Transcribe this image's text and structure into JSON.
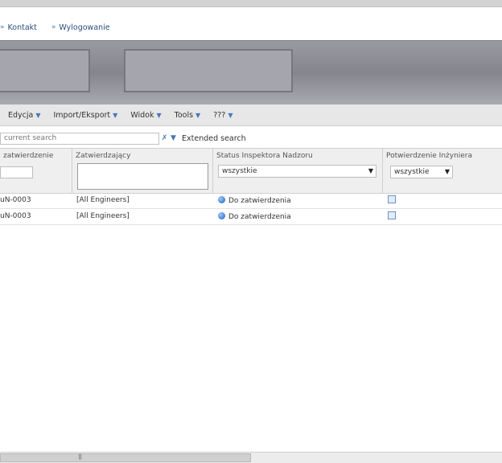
{
  "top_links": [
    {
      "label": "Kontakt",
      "icon": "double-arrow-icon"
    },
    {
      "label": "Wylogowanie",
      "icon": "double-arrow-icon"
    }
  ],
  "menu": [
    {
      "label": "Edycja"
    },
    {
      "label": "Import/Eksport"
    },
    {
      "label": "Widok"
    },
    {
      "label": "Tools"
    },
    {
      "label": "???"
    }
  ],
  "search": {
    "placeholder": "current search",
    "extended_label": "Extended search"
  },
  "grid": {
    "columns": [
      {
        "title": "zatwierdzenie"
      },
      {
        "title": "Zatwierdzający"
      },
      {
        "title": "Status Inspektora Nadzoru",
        "filter_value": "wszystkie"
      },
      {
        "title": "Potwierdzenie Inżyniera",
        "filter_value": "wszystkie"
      }
    ],
    "rows": [
      {
        "id": "uN-0003",
        "approver": "[All Engineers]",
        "status": "Do zatwierdzenia"
      },
      {
        "id": "uN-0003",
        "approver": "[All Engineers]",
        "status": "Do zatwierdzenia"
      }
    ]
  },
  "scrollbar": {
    "grip": "|||"
  },
  "colors": {
    "link": "#2c4d7f",
    "accent": "#4a76b8",
    "banner": "#8f8f98"
  }
}
